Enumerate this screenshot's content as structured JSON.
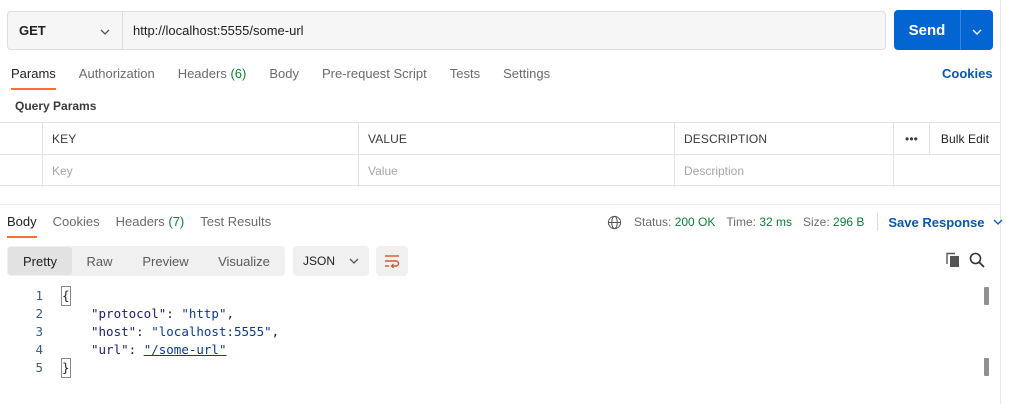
{
  "request": {
    "method": "GET",
    "url": "http://localhost:5555/some-url",
    "send_label": "Send"
  },
  "request_tabs": [
    {
      "label": "Params",
      "active": true
    },
    {
      "label": "Authorization"
    },
    {
      "label": "Headers",
      "count": "(6)"
    },
    {
      "label": "Body"
    },
    {
      "label": "Pre-request Script"
    },
    {
      "label": "Tests"
    },
    {
      "label": "Settings"
    }
  ],
  "cookies_label": "Cookies",
  "query_params": {
    "title": "Query Params",
    "columns": [
      "KEY",
      "VALUE",
      "DESCRIPTION"
    ],
    "more_label": "•••",
    "bulk_edit_label": "Bulk Edit",
    "placeholders": {
      "key": "Key",
      "value": "Value",
      "description": "Description"
    }
  },
  "response_tabs": [
    {
      "label": "Body",
      "active": true
    },
    {
      "label": "Cookies"
    },
    {
      "label": "Headers",
      "count": "(7)"
    },
    {
      "label": "Test Results"
    }
  ],
  "response_status": {
    "status_label": "Status:",
    "status_value": "200 OK",
    "time_label": "Time:",
    "time_value": "32 ms",
    "size_label": "Size:",
    "size_value": "296 B",
    "save_label": "Save Response"
  },
  "format_options": [
    {
      "label": "Pretty",
      "active": true
    },
    {
      "label": "Raw"
    },
    {
      "label": "Preview"
    },
    {
      "label": "Visualize"
    }
  ],
  "language_select": "JSON",
  "code_lines": [
    {
      "n": "1",
      "text": "{"
    },
    {
      "n": "2",
      "key": "\"protocol\"",
      "value": "\"http\"",
      "trail": ","
    },
    {
      "n": "3",
      "key": "\"host\"",
      "value": "\"localhost:5555\"",
      "trail": ","
    },
    {
      "n": "4",
      "key": "\"url\"",
      "value": "\"/some-url\"",
      "trail": ""
    },
    {
      "n": "5",
      "text": "}"
    }
  ],
  "icons": {
    "method_dropdown": "chevron-down-icon",
    "send_dropdown": "chevron-down-icon",
    "globe": "globe-icon",
    "save_dropdown": "chevron-down-icon",
    "json_dropdown": "chevron-down-icon",
    "wrap": "wrap-lines-icon",
    "copy": "copy-icon",
    "search": "search-icon"
  },
  "colors": {
    "accent": "#ff6c37",
    "send": "#0265d2",
    "success": "#0f7b3a",
    "link": "#0b57a8"
  }
}
